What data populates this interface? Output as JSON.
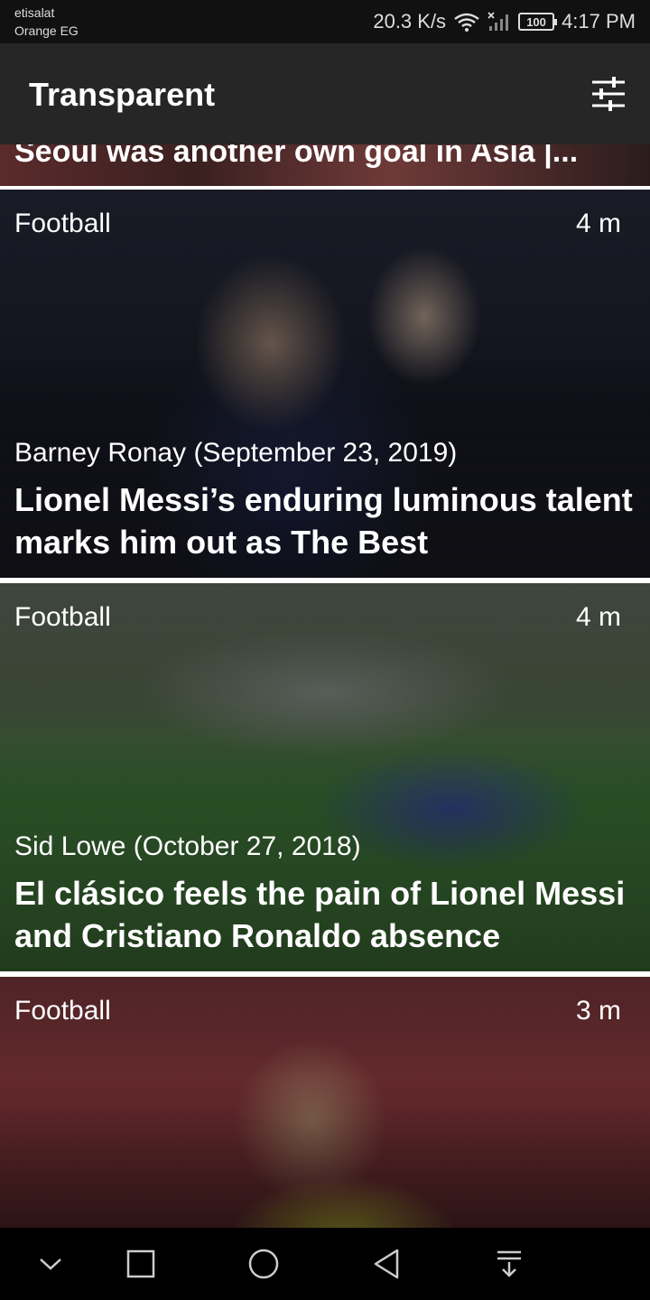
{
  "status_bar": {
    "carrier_line1": "etisalat",
    "carrier_line2": "Orange EG",
    "speed": "20.3 K/s",
    "battery": "100",
    "time": "4:17 PM"
  },
  "app_bar": {
    "title": "Transparent",
    "filter_icon": "tune-icon"
  },
  "feed": {
    "partial_title": "Seoul was another own goal in Asia |...",
    "cards": [
      {
        "category": "Football",
        "age": "4 m",
        "meta": "Barney Ronay (September 23, 2019)",
        "title": "Lionel Messi’s enduring luminous talent marks him out as The Best"
      },
      {
        "category": "Football",
        "age": "4 m",
        "meta": "Sid Lowe (October 27, 2018)",
        "title": "El clásico feels the pain of Lionel Messi and Cristiano Ronaldo absence"
      },
      {
        "category": "Football",
        "age": "3 m"
      }
    ]
  },
  "nav_bar": {
    "icons": [
      "chevron-down-icon",
      "recent-apps-icon",
      "home-icon",
      "back-icon",
      "notification-pull-icon"
    ]
  }
}
